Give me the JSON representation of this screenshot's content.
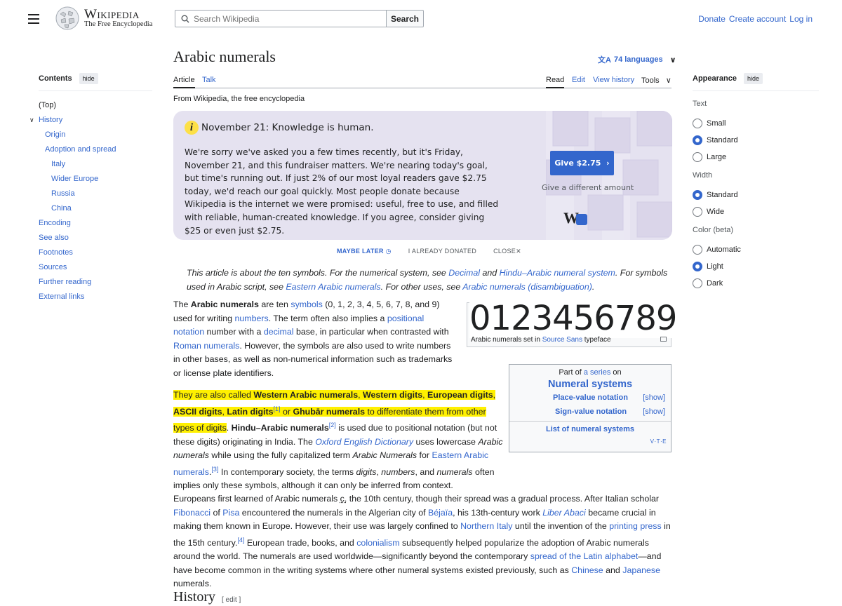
{
  "header": {
    "wordmark": "Wikipedia",
    "tagline": "The Free Encyclopedia",
    "search_placeholder": "Search Wikipedia",
    "search_button": "Search",
    "user_links": [
      "Donate",
      "Create account",
      "Log in"
    ]
  },
  "toc": {
    "title": "Contents",
    "hide": "hide",
    "items": [
      {
        "label": "(Top)",
        "level": 1
      },
      {
        "label": "History",
        "level": 1
      },
      {
        "label": "Origin",
        "level": 2
      },
      {
        "label": "Adoption and spread",
        "level": 2
      },
      {
        "label": "Italy",
        "level": 3
      },
      {
        "label": "Wider Europe",
        "level": 3
      },
      {
        "label": "Russia",
        "level": 3
      },
      {
        "label": "China",
        "level": 3
      },
      {
        "label": "Encoding",
        "level": 1
      },
      {
        "label": "See also",
        "level": 1
      },
      {
        "label": "Footnotes",
        "level": 1
      },
      {
        "label": "Sources",
        "level": 1
      },
      {
        "label": "Further reading",
        "level": 1
      },
      {
        "label": "External links",
        "level": 1
      }
    ]
  },
  "article": {
    "title": "Arabic numerals",
    "languages": "74 languages",
    "tabs_left": [
      "Article",
      "Talk"
    ],
    "tabs_right": [
      "Read",
      "Edit",
      "View history",
      "Tools"
    ],
    "from": "From Wikipedia, the free encyclopedia",
    "hatnote": "This article is about the ten symbols. For the numerical system, see Decimal and Hindu–Arabic numeral system. For symbols used in Arabic script, see Eastern Arabic numerals. For other uses, see Arabic numerals (disambiguation).",
    "history_heading": "History",
    "edit": "[ edit ]"
  },
  "banner": {
    "headline": "November 21: Knowledge is human.",
    "text": "We're sorry we've asked you a few times recently, but it's Friday, November 21, and this fundraiser matters. We're nearing today's goal, but time's running out. If just 2% of our most loyal readers gave $2.75 today, we'd reach our goal quickly. Most people donate because Wikipedia is the internet we were promised: useful, free to use, and filled with reliable, human-created knowledge. If you agree, consider giving $25 or even just $2.75.",
    "give_button": "Give $2.75",
    "give_alt": "Give a different amount",
    "maybe_later": "MAYBE LATER",
    "already_donated": "I ALREADY DONATED",
    "close": "CLOSE"
  },
  "image": {
    "digits": "0123456789",
    "caption_pre": "Arabic numerals set in ",
    "caption_link": "Source Sans",
    "caption_post": " typeface"
  },
  "navbox": {
    "part_of": "Part of ",
    "series": "a series",
    "on": " on",
    "title": "Numeral systems",
    "rows": [
      {
        "label": "Place-value notation",
        "show": "[show]"
      },
      {
        "label": "Sign-value notation",
        "show": "[show]"
      }
    ],
    "list": "List of numeral systems",
    "vte": "V·T·E"
  },
  "appearance": {
    "title": "Appearance",
    "hide": "hide",
    "groups": [
      {
        "label": "Text",
        "options": [
          "Small",
          "Standard",
          "Large"
        ],
        "selected": "Standard"
      },
      {
        "label": "Width",
        "options": [
          "Standard",
          "Wide"
        ],
        "selected": "Standard"
      },
      {
        "label": "Color (beta)",
        "options": [
          "Automatic",
          "Light",
          "Dark"
        ],
        "selected": "Light"
      }
    ]
  }
}
